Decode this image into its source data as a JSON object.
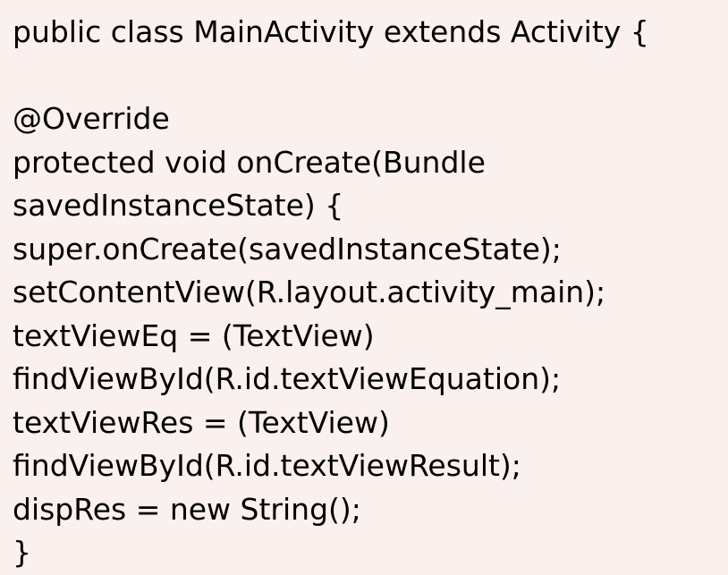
{
  "code": {
    "lines": [
      "public class MainActivity extends Activity {",
      "",
      "@Override",
      "protected void onCreate(Bundle",
      "savedInstanceState) {",
      "super.onCreate(savedInstanceState);",
      "setContentView(R.layout.activity_main);",
      "textViewEq = (TextView)",
      "findViewById(R.id.textViewEquation);",
      "textViewRes = (TextView)",
      "findViewById(R.id.textViewResult);",
      "dispRes = new String();",
      "}"
    ]
  },
  "colors": {
    "background": "#faf0ee",
    "text": "#000000"
  }
}
